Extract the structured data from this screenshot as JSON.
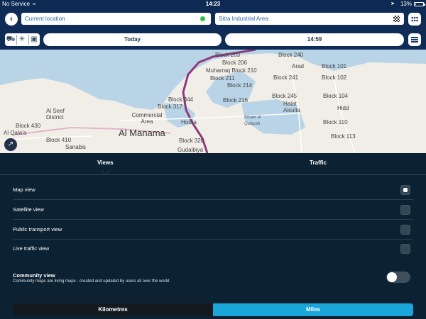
{
  "status_bar": {
    "carrier": "No Service",
    "time": "14:23",
    "battery": "13%",
    "battery_level": 0.13
  },
  "route": {
    "from": "Current location",
    "to": "Sitra Industrial Area"
  },
  "transport_modes": [
    "car",
    "walk",
    "bus"
  ],
  "date_label": "Today",
  "time_label": "14:59",
  "map": {
    "labels": [
      "Block 203",
      "Block 206",
      "Muharraq Block 210",
      "Block 211",
      "Block 214",
      "Block 216",
      "Block 240",
      "Arad",
      "Block 101",
      "Block 241",
      "Block 102",
      "Block 245",
      "Block 104",
      "Halat Alsulta",
      "Hidd",
      "Khawr Al Qulayah",
      "Block 110",
      "Block 113",
      "Block 344",
      "Block 317",
      "Commercial Area",
      "Hoora",
      "Block 320",
      "Gudaibiya",
      "Al Seef District",
      "Block 430",
      "Al Qala'a",
      "Block 410",
      "Sanabis",
      "Al Manama"
    ]
  },
  "tabs": {
    "views": "Views",
    "traffic": "Traffic"
  },
  "options": [
    {
      "label": "Map view",
      "checked": true
    },
    {
      "label": "Satellite view",
      "checked": false
    },
    {
      "label": "Public transport view",
      "checked": false
    },
    {
      "label": "Live traffic view",
      "checked": false
    }
  ],
  "community": {
    "title": "Community view",
    "description": "Community maps are living maps - created and updated by users all over the world",
    "enabled": false
  },
  "units": {
    "kilometres": "Kilometres",
    "miles": "Miles",
    "selected": "Miles"
  },
  "colors": {
    "header": "#0f2c57",
    "panel": "#0c2233",
    "accent": "#1aa6d8",
    "route_line": "#8e3a7e"
  }
}
